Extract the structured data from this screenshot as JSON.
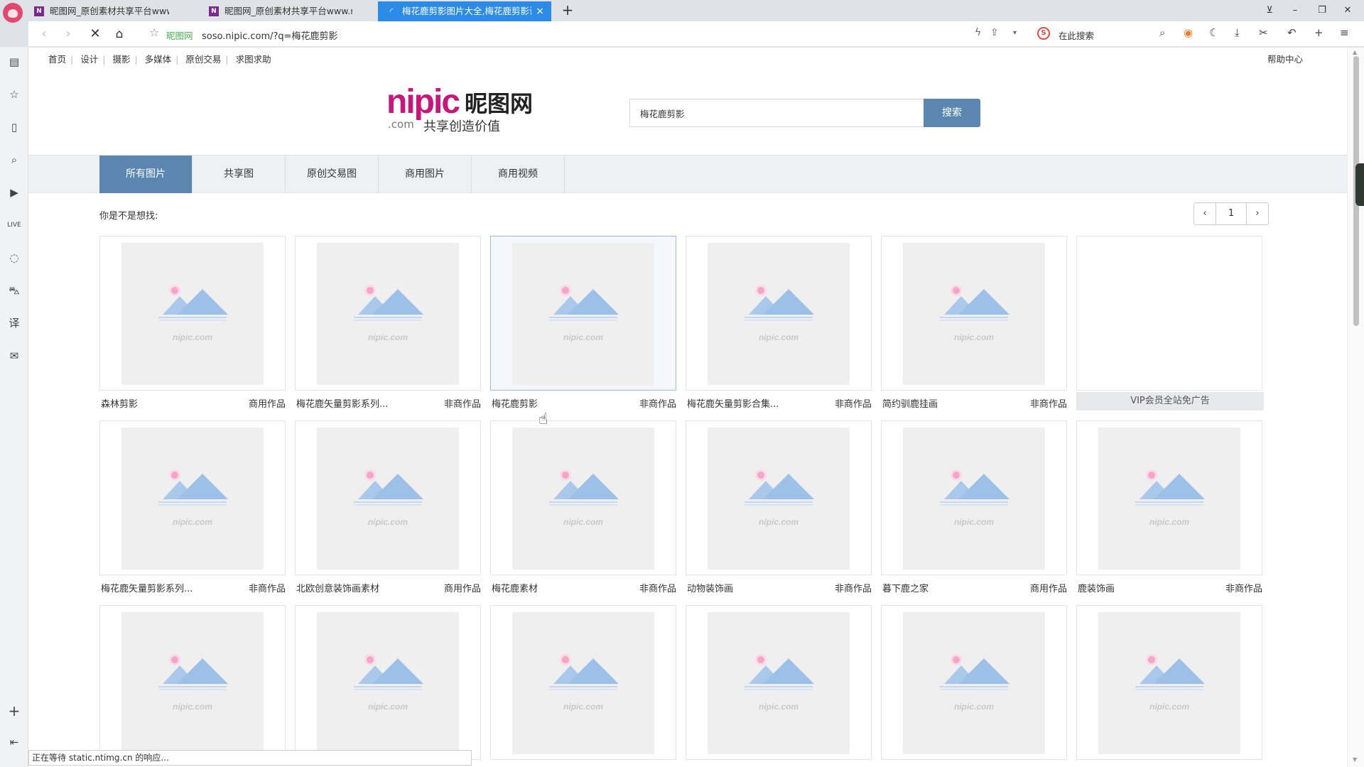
{
  "browser": {
    "tabs": [
      {
        "label": "昵图网_原创素材共享平台www.nipic",
        "favicon": "nipic-favicon"
      },
      {
        "label": "昵图网_原创素材共享平台www.nipic",
        "favicon": "nipic-favicon"
      },
      {
        "label": "梅花鹿剪影图片大全,梅花鹿剪影设计",
        "favicon": "loading-icon"
      }
    ],
    "site_name": "昵图网",
    "url": "soso.nipic.com/?q=梅花鹿剪影",
    "search_placeholder": "在此搜索",
    "status_text": "正在等待 static.ntimg.cn 的响应..."
  },
  "site": {
    "toplinks": [
      "首页",
      "设计",
      "摄影",
      "多媒体",
      "原创交易",
      "求图求助"
    ],
    "help": "帮助中心",
    "logo": {
      "brand": "nipic",
      "cn": "昵图网",
      "com": ".com",
      "slogan": "共享创造价值"
    },
    "search": {
      "query": "梅花鹿剪影",
      "button": "搜索"
    },
    "categories": [
      {
        "label": "所有图片",
        "active": true
      },
      {
        "label": "共享图",
        "active": false
      },
      {
        "label": "原创交易图",
        "active": false
      },
      {
        "label": "商用图片",
        "active": false
      },
      {
        "label": "商用视频",
        "active": false
      }
    ],
    "suggest": "你是不是想找:",
    "pager": {
      "prev": "‹",
      "page": "1",
      "next": "›"
    }
  },
  "results": [
    {
      "title": "森林剪影",
      "type": "商用作品"
    },
    {
      "title": "梅花鹿矢量剪影系列...",
      "type": "非商作品"
    },
    {
      "title": "梅花鹿剪影",
      "type": "非商作品"
    },
    {
      "title": "梅花鹿矢量剪影合集...",
      "type": "非商作品"
    },
    {
      "title": "简约驯鹿挂画",
      "type": "非商作品"
    },
    {
      "title": "VIP会员全站免广告",
      "type": "",
      "ad": true
    },
    {
      "title": "梅花鹿矢量剪影系列...",
      "type": "非商作品"
    },
    {
      "title": "北欧创意装饰画素材",
      "type": "商用作品"
    },
    {
      "title": "梅花鹿素材",
      "type": "非商作品"
    },
    {
      "title": "动物装饰画",
      "type": "非商作品"
    },
    {
      "title": "暮下鹿之家",
      "type": "商用作品"
    },
    {
      "title": "鹿装饰画",
      "type": "非商作品"
    },
    {
      "title": "",
      "type": ""
    },
    {
      "title": "",
      "type": ""
    },
    {
      "title": "",
      "type": ""
    },
    {
      "title": "",
      "type": ""
    },
    {
      "title": "",
      "type": ""
    },
    {
      "title": "",
      "type": ""
    }
  ],
  "thumb_watermark": "nipic.com",
  "colors": {
    "brand": "#c8167c",
    "accent": "#5b86b0",
    "tab_active": "#2b8be6"
  }
}
